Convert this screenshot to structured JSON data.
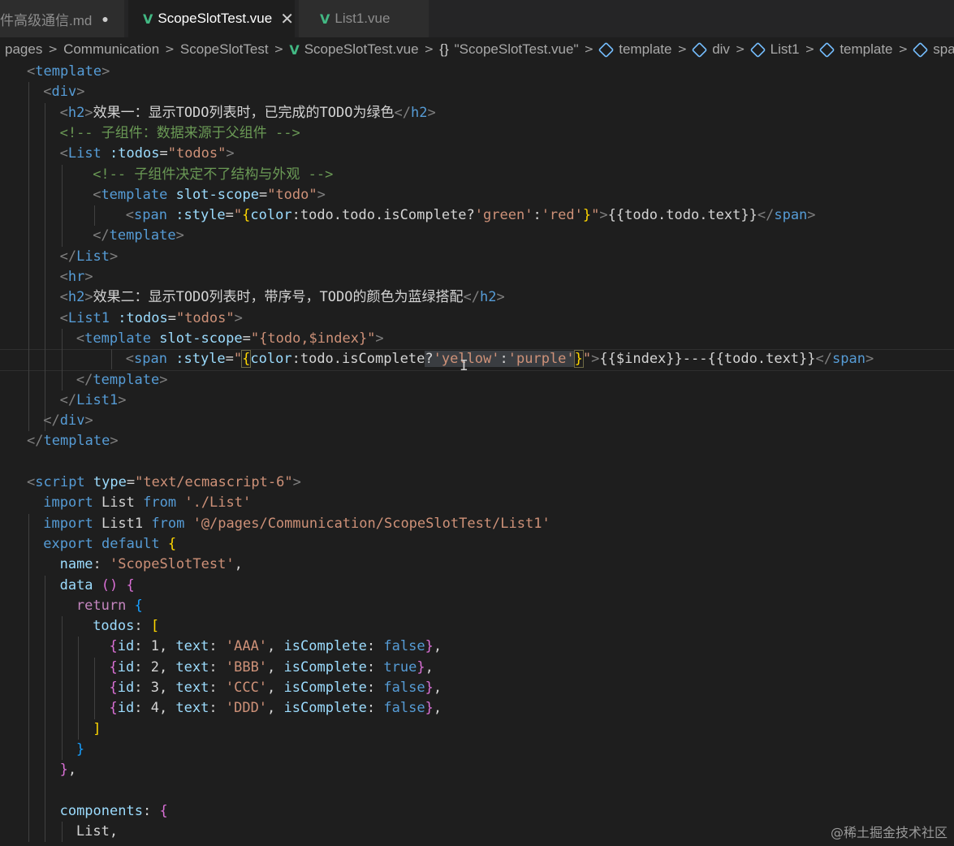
{
  "tabs": [
    {
      "label": "件高级通信.md",
      "indicator": "●"
    },
    {
      "label": "ScopeSlotTest.vue",
      "indicator": "✕"
    },
    {
      "label": "List1.vue",
      "indicator": ""
    }
  ],
  "breadcrumb": [
    "pages",
    "Communication",
    "ScopeSlotTest",
    "ScopeSlotTest.vue",
    "\"ScopeSlotTest.vue\"",
    "template",
    "div",
    "List1",
    "template",
    "span"
  ],
  "code": [
    [
      [
        "t-punc",
        "<"
      ],
      [
        "t-tag",
        "template"
      ],
      [
        "t-punc",
        ">"
      ]
    ],
    [
      [
        "t-punc",
        "<"
      ],
      [
        "t-tag",
        "div"
      ],
      [
        "t-punc",
        ">"
      ]
    ],
    [
      [
        "t-punc",
        "<"
      ],
      [
        "t-tag",
        "h2"
      ],
      [
        "t-punc",
        ">"
      ],
      [
        "t-text",
        "效果一：显示TODO列表时，已完成的TODO为绿色"
      ],
      [
        "t-punc",
        "</"
      ],
      [
        "t-tag",
        "h2"
      ],
      [
        "t-punc",
        ">"
      ]
    ],
    [
      [
        "t-cmt",
        "<!-- 子组件：数据来源于父组件 -->"
      ]
    ],
    [
      [
        "t-punc",
        "<"
      ],
      [
        "t-tag",
        "List"
      ],
      [
        "t-text",
        " "
      ],
      [
        "t-attr",
        ":todos"
      ],
      [
        "t-text",
        "="
      ],
      [
        "t-str",
        "\"todos\""
      ],
      [
        "t-punc",
        ">"
      ]
    ],
    [
      [
        "t-cmt",
        "<!-- 子组件决定不了结构与外观 -->"
      ]
    ],
    [
      [
        "t-punc",
        "<"
      ],
      [
        "t-tag",
        "template"
      ],
      [
        "t-text",
        " "
      ],
      [
        "t-attr",
        "slot-scope"
      ],
      [
        "t-text",
        "="
      ],
      [
        "t-str",
        "\"todo\""
      ],
      [
        "t-punc",
        ">"
      ]
    ],
    [
      [
        "t-punc",
        "<"
      ],
      [
        "t-tag",
        "span"
      ],
      [
        "t-text",
        " "
      ],
      [
        "t-attr",
        ":style"
      ],
      [
        "t-text",
        "="
      ],
      [
        "t-str",
        "\""
      ],
      [
        "t-b1",
        "{"
      ],
      [
        "t-attr",
        "color"
      ],
      [
        "t-text",
        ":todo.todo.isComplete?"
      ],
      [
        "t-str",
        "'green'"
      ],
      [
        "t-text",
        ":"
      ],
      [
        "t-str",
        "'red'"
      ],
      [
        "t-b1",
        "}"
      ],
      [
        "t-str",
        "\""
      ],
      [
        "t-punc",
        ">"
      ],
      [
        "t-text",
        "{{todo.todo.text}}"
      ],
      [
        "t-punc",
        "</"
      ],
      [
        "t-tag",
        "span"
      ],
      [
        "t-punc",
        ">"
      ]
    ],
    [
      [
        "t-punc",
        "</"
      ],
      [
        "t-tag",
        "template"
      ],
      [
        "t-punc",
        ">"
      ]
    ],
    [
      [
        "t-punc",
        "</"
      ],
      [
        "t-tag",
        "List"
      ],
      [
        "t-punc",
        ">"
      ]
    ],
    [
      [
        "t-punc",
        "<"
      ],
      [
        "t-tag",
        "hr"
      ],
      [
        "t-punc",
        ">"
      ]
    ],
    [
      [
        "t-punc",
        "<"
      ],
      [
        "t-tag",
        "h2"
      ],
      [
        "t-punc",
        ">"
      ],
      [
        "t-text",
        "效果二：显示TODO列表时，带序号，TODO的颜色为蓝绿搭配"
      ],
      [
        "t-punc",
        "</"
      ],
      [
        "t-tag",
        "h2"
      ],
      [
        "t-punc",
        ">"
      ]
    ],
    [
      [
        "t-punc",
        "<"
      ],
      [
        "t-tag",
        "List1"
      ],
      [
        "t-text",
        " "
      ],
      [
        "t-attr",
        ":todos"
      ],
      [
        "t-text",
        "="
      ],
      [
        "t-str",
        "\"todos\""
      ],
      [
        "t-punc",
        ">"
      ]
    ],
    [
      [
        "t-punc",
        "<"
      ],
      [
        "t-tag",
        "template"
      ],
      [
        "t-text",
        " "
      ],
      [
        "t-attr",
        "slot-scope"
      ],
      [
        "t-text",
        "="
      ],
      [
        "t-str",
        "\"{todo,$index}\""
      ],
      [
        "t-punc",
        ">"
      ]
    ],
    [
      [
        "t-punc",
        "<"
      ],
      [
        "t-tag",
        "span"
      ],
      [
        "t-text",
        " "
      ],
      [
        "t-attr",
        ":style"
      ],
      [
        "t-text",
        "="
      ],
      [
        "t-str",
        "\""
      ],
      [
        "t-b1 bracket",
        "{"
      ],
      [
        "t-attr",
        "color"
      ],
      [
        "t-text",
        ":todo.isComplete"
      ],
      [
        "t-text sel",
        "?"
      ],
      [
        "t-str sel",
        "'yellow'"
      ],
      [
        "t-text sel",
        ":"
      ],
      [
        "t-str sel",
        "'purple'"
      ],
      [
        "t-b1 bracket",
        "}"
      ],
      [
        "t-str",
        "\""
      ],
      [
        "t-punc",
        ">"
      ],
      [
        "t-text",
        "{{$index}}---{{todo.text}}"
      ],
      [
        "t-punc",
        "</"
      ],
      [
        "t-tag",
        "span"
      ],
      [
        "t-punc",
        ">"
      ]
    ],
    [
      [
        "t-punc",
        "</"
      ],
      [
        "t-tag",
        "template"
      ],
      [
        "t-punc",
        ">"
      ]
    ],
    [
      [
        "t-punc",
        "</"
      ],
      [
        "t-tag",
        "List1"
      ],
      [
        "t-punc",
        ">"
      ]
    ],
    [
      [
        "t-punc",
        "</"
      ],
      [
        "t-tag",
        "div"
      ],
      [
        "t-punc",
        ">"
      ]
    ],
    [
      [
        "t-punc",
        "</"
      ],
      [
        "t-tag",
        "template"
      ],
      [
        "t-punc",
        ">"
      ]
    ],
    [],
    [
      [
        "t-punc",
        "<"
      ],
      [
        "t-tag",
        "script"
      ],
      [
        "t-text",
        " "
      ],
      [
        "t-attr",
        "type"
      ],
      [
        "t-text",
        "="
      ],
      [
        "t-str",
        "\"text/ecmascript-6\""
      ],
      [
        "t-punc",
        ">"
      ]
    ],
    [
      [
        "t-kw",
        "import"
      ],
      [
        "t-text",
        " List "
      ],
      [
        "t-kw",
        "from"
      ],
      [
        "t-text",
        " "
      ],
      [
        "t-str",
        "'./List'"
      ]
    ],
    [
      [
        "t-kw",
        "import"
      ],
      [
        "t-text",
        " List1 "
      ],
      [
        "t-kw",
        "from"
      ],
      [
        "t-text",
        " "
      ],
      [
        "t-str",
        "'@/pages/Communication/ScopeSlotTest/List1'"
      ]
    ],
    [
      [
        "t-kw",
        "export"
      ],
      [
        "t-text",
        " "
      ],
      [
        "t-kw",
        "default"
      ],
      [
        "t-text",
        " "
      ],
      [
        "t-b1",
        "{"
      ]
    ],
    [
      [
        "t-attr",
        "name"
      ],
      [
        "t-text",
        ": "
      ],
      [
        "t-str",
        "'ScopeSlotTest'"
      ],
      [
        "t-text",
        ","
      ]
    ],
    [
      [
        "t-attr",
        "data"
      ],
      [
        "t-text",
        " "
      ],
      [
        "t-b2",
        "()"
      ],
      [
        "t-text",
        " "
      ],
      [
        "t-b2",
        "{"
      ]
    ],
    [
      [
        "t-ctrl",
        "return"
      ],
      [
        "t-text",
        " "
      ],
      [
        "t-b3",
        "{"
      ]
    ],
    [
      [
        "t-attr",
        "todos"
      ],
      [
        "t-text",
        ": "
      ],
      [
        "t-b1",
        "["
      ]
    ],
    [
      [
        "t-b2",
        "{"
      ],
      [
        "t-attr",
        "id"
      ],
      [
        "t-text",
        ": 1, "
      ],
      [
        "t-attr",
        "text"
      ],
      [
        "t-text",
        ": "
      ],
      [
        "t-str",
        "'AAA'"
      ],
      [
        "t-text",
        ", "
      ],
      [
        "t-attr",
        "isComplete"
      ],
      [
        "t-text",
        ": "
      ],
      [
        "t-kw",
        "false"
      ],
      [
        "t-b2",
        "}"
      ],
      [
        "t-text",
        ","
      ]
    ],
    [
      [
        "t-b2",
        "{"
      ],
      [
        "t-attr",
        "id"
      ],
      [
        "t-text",
        ": 2, "
      ],
      [
        "t-attr",
        "text"
      ],
      [
        "t-text",
        ": "
      ],
      [
        "t-str",
        "'BBB'"
      ],
      [
        "t-text",
        ", "
      ],
      [
        "t-attr",
        "isComplete"
      ],
      [
        "t-text",
        ": "
      ],
      [
        "t-kw",
        "true"
      ],
      [
        "t-b2",
        "}"
      ],
      [
        "t-text",
        ","
      ]
    ],
    [
      [
        "t-b2",
        "{"
      ],
      [
        "t-attr",
        "id"
      ],
      [
        "t-text",
        ": 3, "
      ],
      [
        "t-attr",
        "text"
      ],
      [
        "t-text",
        ": "
      ],
      [
        "t-str",
        "'CCC'"
      ],
      [
        "t-text",
        ", "
      ],
      [
        "t-attr",
        "isComplete"
      ],
      [
        "t-text",
        ": "
      ],
      [
        "t-kw",
        "false"
      ],
      [
        "t-b2",
        "}"
      ],
      [
        "t-text",
        ","
      ]
    ],
    [
      [
        "t-b2",
        "{"
      ],
      [
        "t-attr",
        "id"
      ],
      [
        "t-text",
        ": 4, "
      ],
      [
        "t-attr",
        "text"
      ],
      [
        "t-text",
        ": "
      ],
      [
        "t-str",
        "'DDD'"
      ],
      [
        "t-text",
        ", "
      ],
      [
        "t-attr",
        "isComplete"
      ],
      [
        "t-text",
        ": "
      ],
      [
        "t-kw",
        "false"
      ],
      [
        "t-b2",
        "}"
      ],
      [
        "t-text",
        ","
      ]
    ],
    [
      [
        "t-b1",
        "]"
      ]
    ],
    [
      [
        "t-b3",
        "}"
      ]
    ],
    [
      [
        "t-b2",
        "}"
      ],
      [
        "t-text",
        ","
      ]
    ],
    [],
    [
      [
        "t-attr",
        "components"
      ],
      [
        "t-text",
        ": "
      ],
      [
        "t-b2",
        "{"
      ]
    ],
    [
      [
        "t-text",
        "List,"
      ]
    ]
  ],
  "watermark": "@稀土掘金技术社区",
  "colors": {
    "background": "#1e1e1e",
    "tag": "#569cd6",
    "attribute": "#9cdcfe",
    "string": "#ce9178",
    "comment": "#6a9955",
    "vue": "#42b883"
  }
}
